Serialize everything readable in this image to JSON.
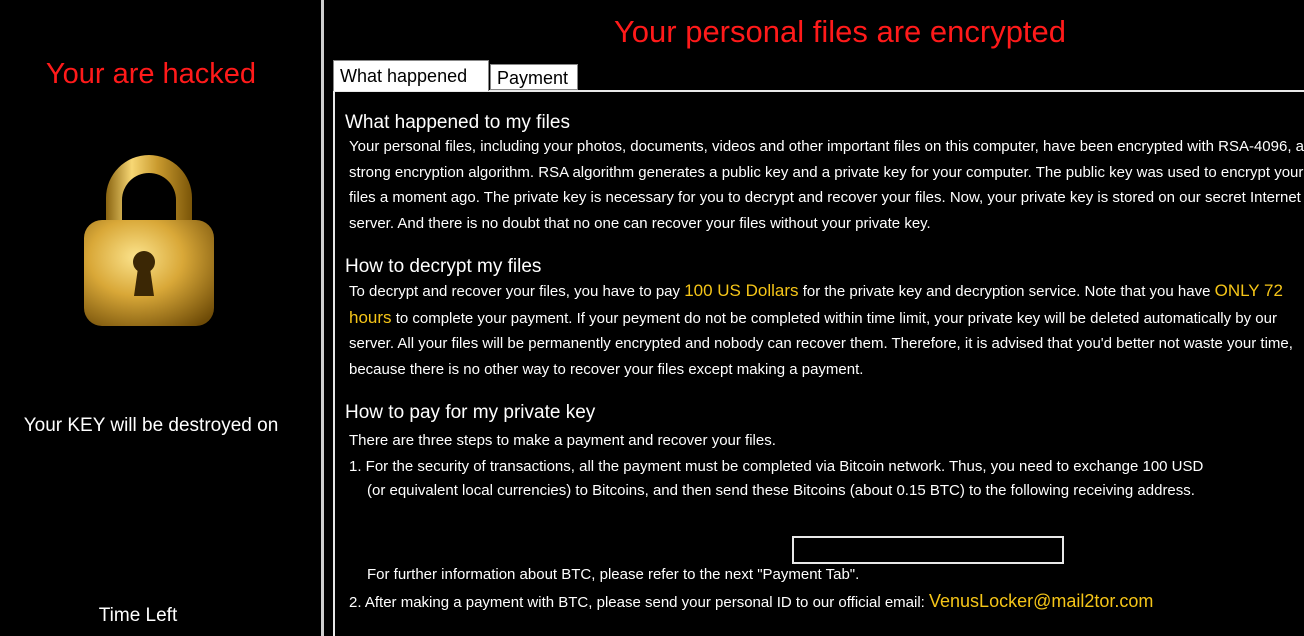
{
  "left": {
    "hacked_title": "Your are hacked",
    "key_text": "Your KEY will be destroyed on",
    "time_left": "Time Left"
  },
  "main": {
    "title": "Your personal files are encrypted",
    "tabs": [
      {
        "label": "What happened",
        "active": true
      },
      {
        "label": "Payment",
        "active": false
      }
    ]
  },
  "sections": {
    "what_heading": "What happened to my files",
    "what_body": "Your personal files, including your photos, documents, videos and other important files on this computer, have been encrypted with RSA-4096, a strong encryption algorithm. RSA algorithm generates a public key and a private key for your computer. The public key was used to encrypt your files a moment ago. The private key is necessary for you to decrypt and recover your files. Now, your private key is stored on our secret Internet server. And there is no doubt that no one can recover your files without your private key.",
    "decrypt_heading": "How to decrypt my files",
    "decrypt_pre": "To decrypt and recover your files, you have to pay",
    "price": "100 US Dollars",
    "decrypt_mid": "for the private key and decryption service. Note that you have",
    "deadline": "ONLY 72 hours",
    "decrypt_post": "to complete your payment. If your peyment do not be completed within time limit, your private key will be deleted automatically by our server. All your files will be permanently encrypted and nobody can recover them. Therefore, it is advised that you'd better not waste your time, because there is no other way to recover your files except making a payment.",
    "pay_heading": "How to pay for my private key",
    "pay_intro": "There are three steps to make a payment and recover your files.",
    "step1": "1. For the security of transactions, all the payment must be completed via Bitcoin network. Thus, you need to exchange 100 USD",
    "step1b": "(or equivalent local currencies) to Bitcoins, and then send these Bitcoins (about 0.15 BTC) to the following receiving address.",
    "btc_address": "",
    "btc_note": "For further information about BTC, please refer to the next \"Payment Tab\".",
    "step2": "2. After making a payment with BTC, please send your personal ID to our official email:",
    "email": "VenusLocker@mail2tor.com"
  },
  "colors": {
    "alert_red": "#ff1a1a",
    "highlight_yellow": "#f5c518"
  },
  "icons": {
    "lock": "padlock-icon"
  }
}
